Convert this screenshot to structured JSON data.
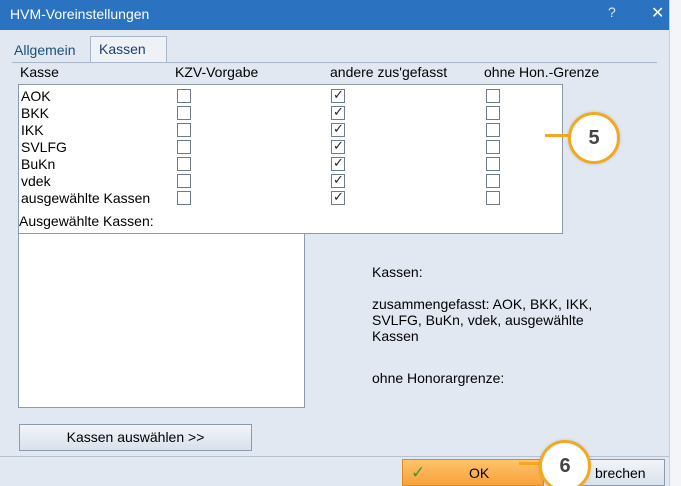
{
  "window": {
    "title": "HVM-Voreinstellungen",
    "help_label": "?",
    "close_label": "✕"
  },
  "tabs": [
    {
      "label": "Allgemein"
    },
    {
      "label": "Kassen"
    }
  ],
  "columns": {
    "kasse": "Kasse",
    "kzv": "KZV-Vorgabe",
    "andere": "andere zus'gefasst",
    "ohne": "ohne Hon.-Grenze"
  },
  "rows": [
    {
      "label": "AOK",
      "kzv": false,
      "andere": true,
      "ohne": false
    },
    {
      "label": "BKK",
      "kzv": false,
      "andere": true,
      "ohne": false
    },
    {
      "label": "IKK",
      "kzv": false,
      "andere": true,
      "ohne": false
    },
    {
      "label": "SVLFG",
      "kzv": false,
      "andere": true,
      "ohne": false
    },
    {
      "label": "BuKn",
      "kzv": false,
      "andere": true,
      "ohne": false
    },
    {
      "label": "vdek",
      "kzv": false,
      "andere": true,
      "ohne": false
    },
    {
      "label": "ausgewählte Kassen",
      "kzv": false,
      "andere": true,
      "ohne": false
    }
  ],
  "selected_section": {
    "label": "Ausgewählte Kassen:"
  },
  "info": {
    "heading": "Kassen:",
    "zusammengefasst_line1": "zusammengefasst: AOK, BKK, IKK,",
    "zusammengefasst_line2": "SVLFG, BuKn, vdek, ausgewählte",
    "zusammengefasst_line3": "Kassen",
    "ohne_grenze": "ohne Honorargrenze:"
  },
  "buttons": {
    "kassen_auswaehlen": "Kassen auswählen >>",
    "ok": "OK",
    "cancel_visible": "brechen"
  },
  "badges": {
    "b5": "5",
    "b6": "6"
  },
  "icons": {
    "check_mark": "✓",
    "ok_icon": "✓"
  },
  "colors": {
    "titlebar": "#2b73c0",
    "badge_ring": "#f3a81d",
    "ok_button": "#f7a23a"
  }
}
